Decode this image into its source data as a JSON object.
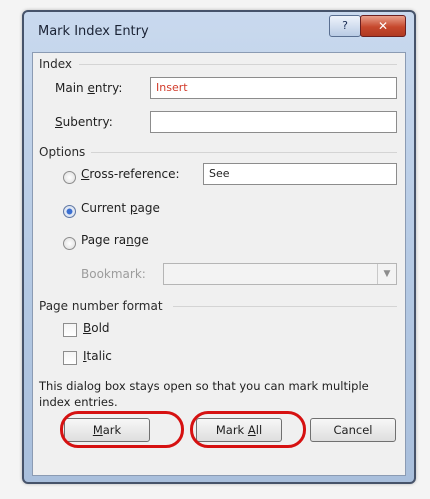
{
  "dialog": {
    "title": "Mark Index Entry",
    "help_label": "?",
    "close_label": "✕"
  },
  "index": {
    "group_label": "Index",
    "main_entry_label_pre": "Main ",
    "main_entry_label_u": "e",
    "main_entry_label_post": "ntry:",
    "main_entry_value": "Insert",
    "subentry_label_u": "S",
    "subentry_label_post": "ubentry:",
    "subentry_value": ""
  },
  "options": {
    "group_label": "Options",
    "cross_reference": {
      "label_u": "C",
      "label_post": "ross-reference:",
      "value": "See",
      "selected": false
    },
    "current_page": {
      "label_pre": "Current ",
      "label_u": "p",
      "label_post": "age",
      "selected": true
    },
    "page_range": {
      "label_pre": "Page ra",
      "label_u": "n",
      "label_post": "ge",
      "selected": false,
      "bookmark_label": "Bookmark:",
      "bookmark_value": ""
    }
  },
  "page_number_format": {
    "group_label": "Page number format",
    "bold_label_u": "B",
    "bold_label_post": "old",
    "italic_label_u": "I",
    "italic_label_post": "talic",
    "bold_checked": false,
    "italic_checked": false
  },
  "info_text_line1": "This dialog box stays open so that you can mark multiple",
  "info_text_line2": "index entries.",
  "buttons": {
    "mark_u": "M",
    "mark_post": "ark",
    "mark_all_pre": "Mark ",
    "mark_all_u": "A",
    "mark_all_post": "ll",
    "cancel": "Cancel"
  },
  "colors": {
    "highlight_oval": "#d61111",
    "main_entry_text": "#d23b2b"
  }
}
